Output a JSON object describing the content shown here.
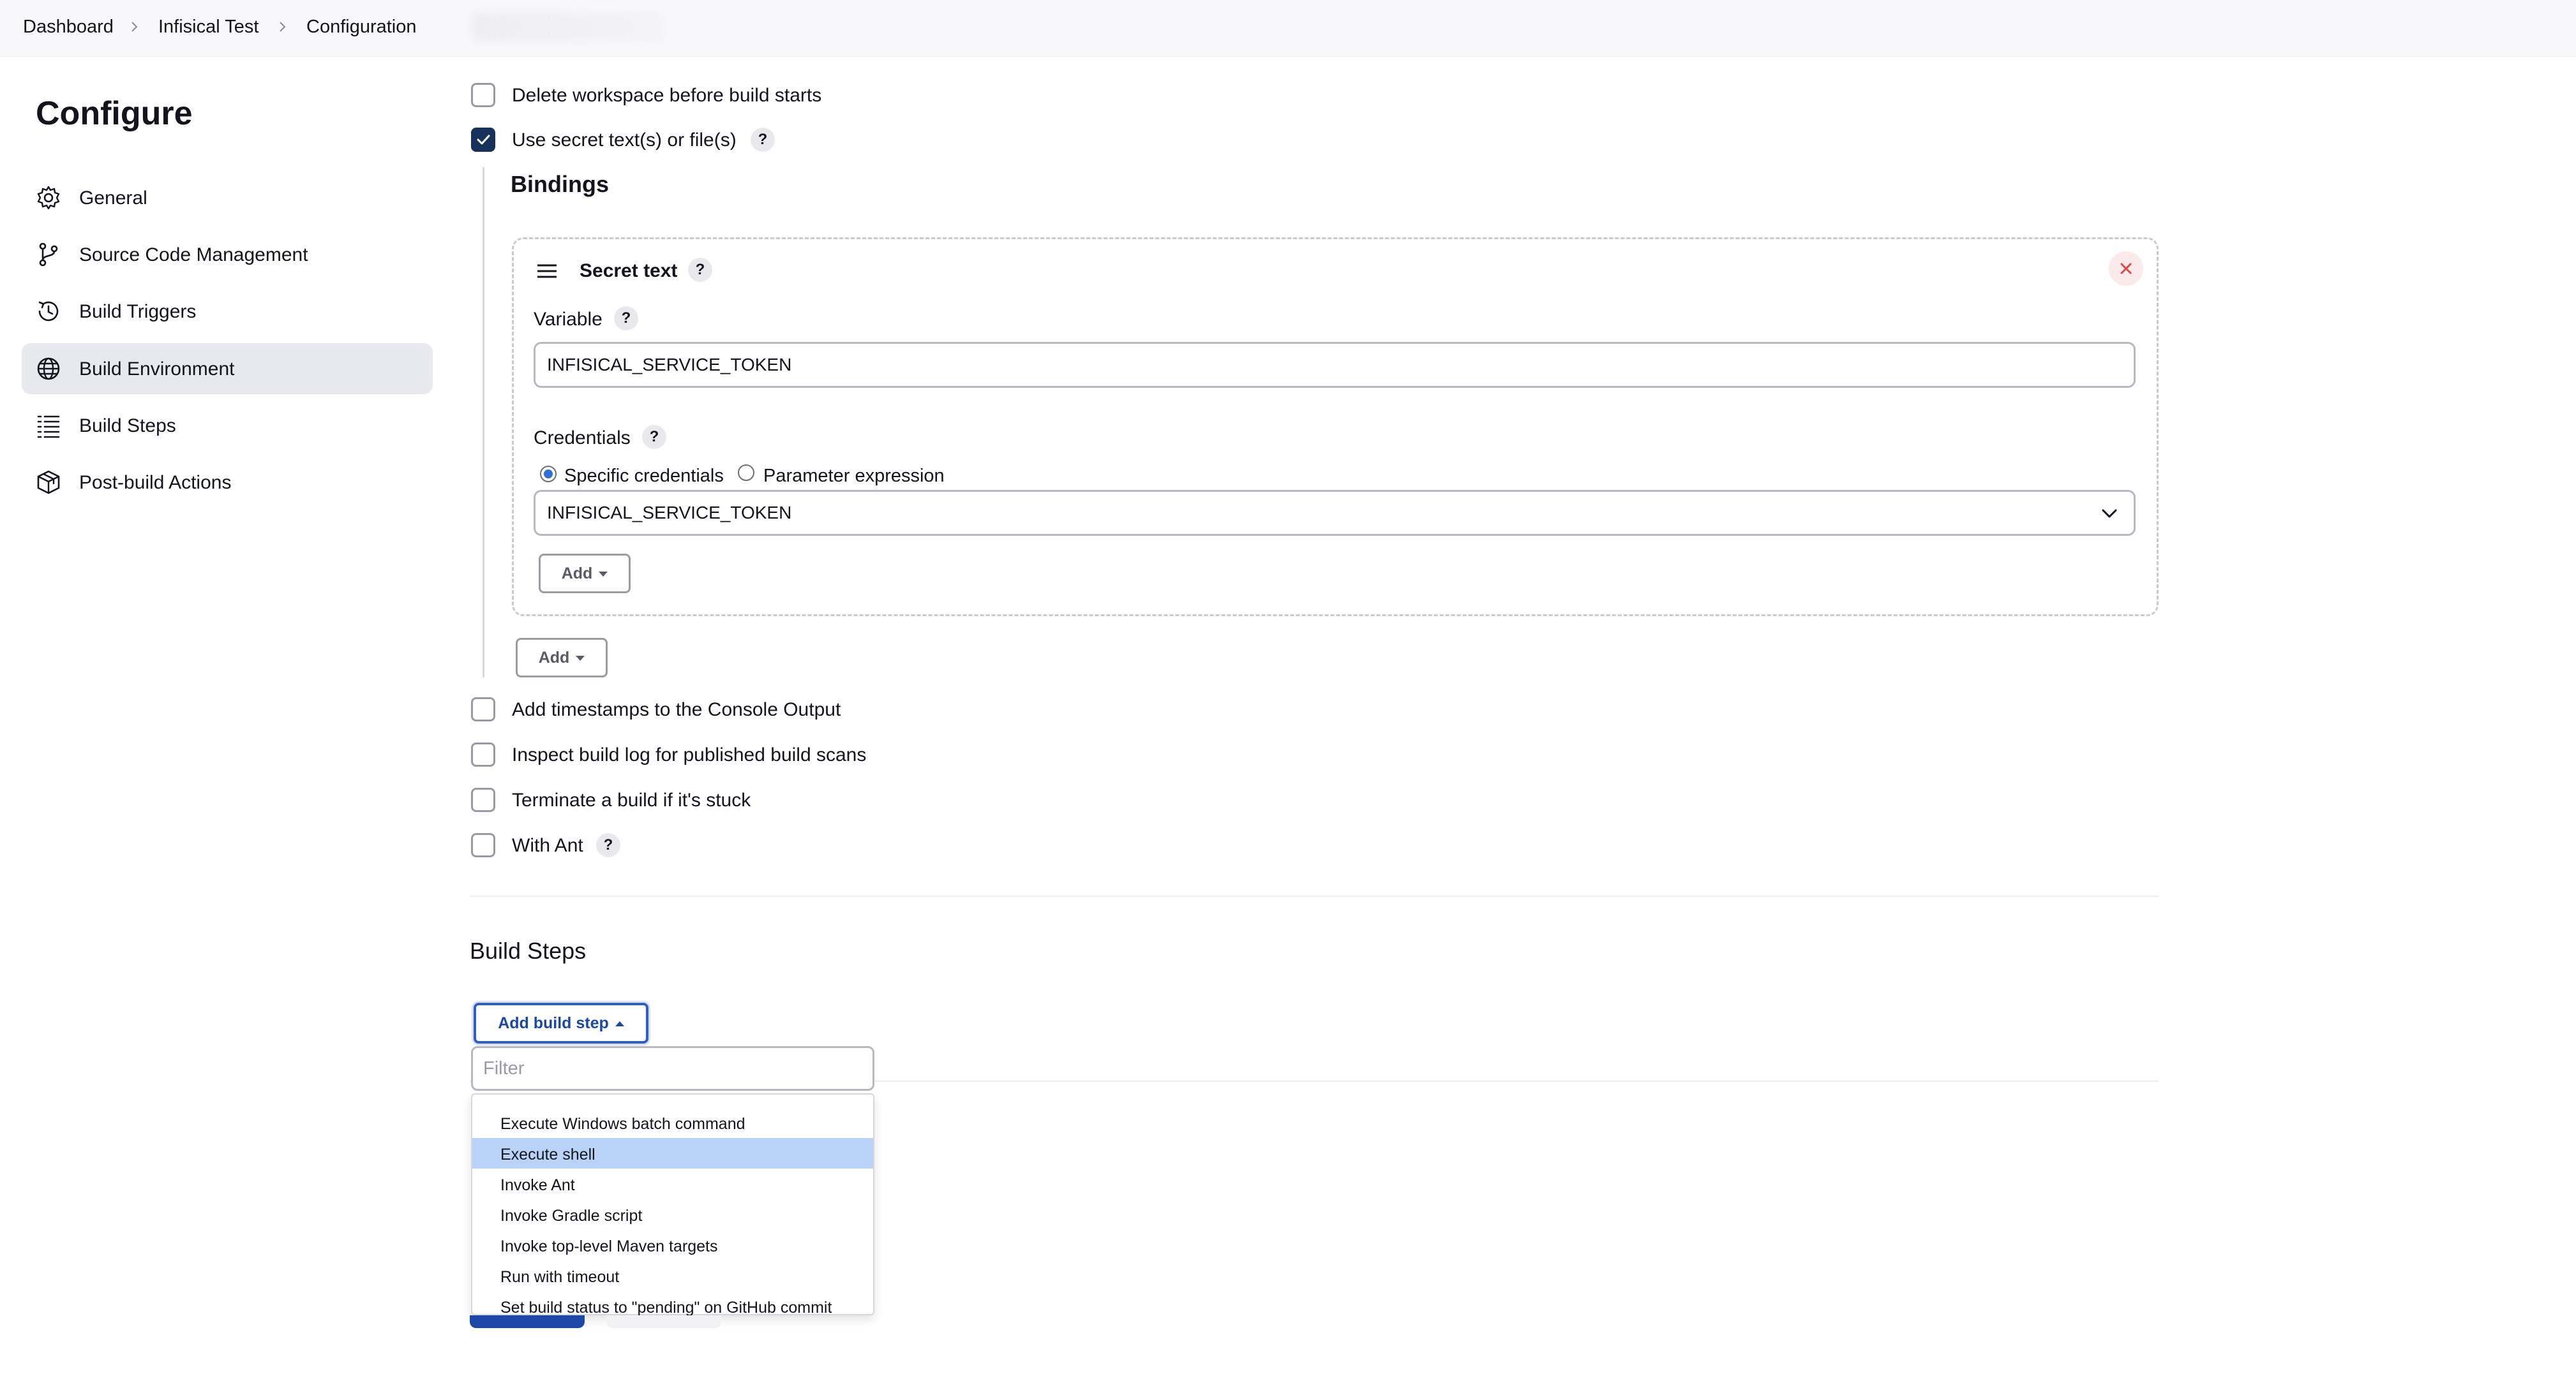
{
  "breadcrumb": {
    "items": [
      "Dashboard",
      "Infisical Test",
      "Configuration"
    ]
  },
  "sidebar": {
    "title": "Configure",
    "items": [
      {
        "label": "General",
        "icon": "gear-icon"
      },
      {
        "label": "Source Code Management",
        "icon": "git-branch-icon"
      },
      {
        "label": "Build Triggers",
        "icon": "clock-icon"
      },
      {
        "label": "Build Environment",
        "icon": "globe-icon",
        "active": true
      },
      {
        "label": "Build Steps",
        "icon": "list-icon"
      },
      {
        "label": "Post-build Actions",
        "icon": "package-icon"
      }
    ]
  },
  "environment": {
    "delete_workspace": {
      "label": "Delete workspace before build starts",
      "checked": false
    },
    "use_secret": {
      "label": "Use secret text(s) or file(s)",
      "checked": true
    },
    "help_symbol": "?",
    "bindings": {
      "title": "Bindings",
      "secret_text": {
        "title": "Secret text",
        "variable_label": "Variable",
        "variable_value": "INFISICAL_SERVICE_TOKEN",
        "credentials_label": "Credentials",
        "radio_specific": "Specific credentials",
        "radio_parameter": "Parameter expression",
        "selected_credential": "INFISICAL_SERVICE_TOKEN",
        "add_label": "Add"
      },
      "add_label": "Add"
    },
    "timestamps": {
      "label": "Add timestamps to the Console Output",
      "checked": false
    },
    "inspect_log": {
      "label": "Inspect build log for published build scans",
      "checked": false
    },
    "terminate_stuck": {
      "label": "Terminate a build if it's stuck",
      "checked": false
    },
    "with_ant": {
      "label": "With Ant",
      "checked": false
    }
  },
  "build_steps": {
    "title": "Build Steps",
    "add_button": "Add build step",
    "filter_placeholder": "Filter",
    "menu": [
      "Execute Windows batch command",
      "Execute shell",
      "Invoke Ant",
      "Invoke Gradle script",
      "Invoke top-level Maven targets",
      "Run with timeout",
      "Set build status to \"pending\" on GitHub commit"
    ],
    "highlighted": "Execute shell"
  },
  "colors": {
    "accent": "#2f5fc2",
    "checkbox_checked": "#17325a",
    "active_nav_bg": "#e8e9ee",
    "menu_highlight": "#b9d3f6",
    "remove_red": "#e04848"
  }
}
